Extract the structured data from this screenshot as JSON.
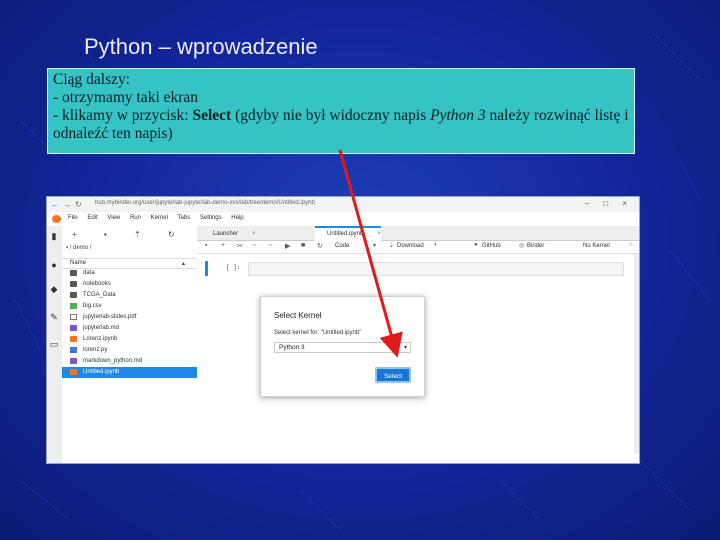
{
  "slide": {
    "title": "Python – wprowadzenie",
    "text": {
      "line1": "Ciąg dalszy:",
      "line2": "- otrzymamy taki ekran",
      "line3_pre": "- klikamy w przycisk: ",
      "line3_bold": "Select",
      "line3_mid": " (gdyby nie był widoczny napis ",
      "line3_italic": "Python 3",
      "line3_post": " należy rozwinąć listę i odnaleźć ten napis)"
    },
    "colors": {
      "background": "#13259a",
      "textbox": "#36c3c3",
      "arrow": "#e0191b"
    }
  },
  "browser": {
    "url": "hub.mybinder.org/user/jupyterlab-jupyterlab-demo-xxx/lab/tree/demo/Untitled.ipynb",
    "window_buttons": "– □ ×"
  },
  "menubar": [
    "File",
    "Edit",
    "View",
    "Run",
    "Kernel",
    "Tabs",
    "Settings",
    "Help"
  ],
  "filebrowser": {
    "path": "/ demo /",
    "column_header": "Name",
    "files": [
      {
        "name": "data",
        "type": "folder"
      },
      {
        "name": "notebooks",
        "type": "folder"
      },
      {
        "name": "TCGA_Data",
        "type": "folder"
      },
      {
        "name": "big.csv",
        "type": "csv"
      },
      {
        "name": "jupyterlab-slides.pdf",
        "type": "txt"
      },
      {
        "name": "jupyterlab.md",
        "type": "md"
      },
      {
        "name": "Lorenz.ipynb",
        "type": "nb"
      },
      {
        "name": "lorenz.py",
        "type": "py"
      },
      {
        "name": "markdown_python.md",
        "type": "md"
      },
      {
        "name": "Untitled.ipynb",
        "type": "nb",
        "selected": true
      }
    ]
  },
  "tabs": [
    {
      "label": "Launcher"
    },
    {
      "label": "Untitled.ipynb",
      "active": true
    }
  ],
  "notebook_toolbar": {
    "cell_type": "Code",
    "download": "Download",
    "github": "GitHub",
    "binder": "Binder",
    "kernel_status": "No Kernel"
  },
  "cell": {
    "prompt": "[ ]:"
  },
  "dialog": {
    "title": "Select Kernel",
    "label": "Select kernel for: \"Untitled.ipynb\"",
    "selected_kernel": "Python 3",
    "button": "Select"
  }
}
